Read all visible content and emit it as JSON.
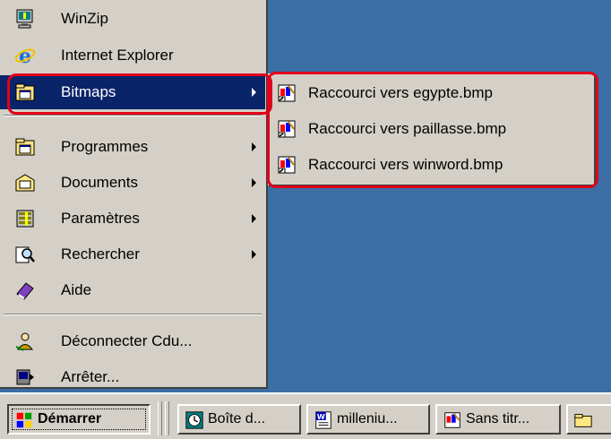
{
  "start_menu": {
    "top_items": [
      {
        "label": "WinZip",
        "icon": "winzip-icon"
      },
      {
        "label": "Internet Explorer",
        "icon": "internet-explorer-icon"
      },
      {
        "label": "Bitmaps",
        "icon": "folder-program-icon",
        "selected": true,
        "has_submenu": true
      }
    ],
    "main_items": [
      {
        "label": "Programmes",
        "icon": "programs-folder-icon",
        "has_submenu": true
      },
      {
        "label": "Documents",
        "icon": "documents-folder-icon",
        "has_submenu": true
      },
      {
        "label": "Paramètres",
        "icon": "settings-icon",
        "has_submenu": true
      },
      {
        "label": "Rechercher",
        "icon": "search-icon",
        "has_submenu": true
      },
      {
        "label": "Aide",
        "icon": "help-book-icon",
        "has_submenu": false
      }
    ],
    "bottom_items": [
      {
        "label": "Déconnecter Cdu...",
        "icon": "logoff-icon"
      },
      {
        "label": "Arrêter...",
        "icon": "shutdown-icon"
      }
    ]
  },
  "submenu": {
    "items": [
      {
        "label": "Raccourci vers egypte.bmp",
        "icon": "paint-shortcut-icon"
      },
      {
        "label": "Raccourci vers paillasse.bmp",
        "icon": "paint-shortcut-icon"
      },
      {
        "label": "Raccourci vers winword.bmp",
        "icon": "paint-shortcut-icon"
      }
    ]
  },
  "taskbar": {
    "start_label": "Démarrer",
    "buttons": [
      {
        "label": "Boîte d...",
        "icon": "outlook-icon"
      },
      {
        "label": "milleniu...",
        "icon": "word-doc-icon"
      },
      {
        "label": "Sans titr...",
        "icon": "paint-icon"
      }
    ]
  },
  "colors": {
    "desktop": "#3a6ea5",
    "menu_face": "#d4d0c8",
    "selection": "#0a246a",
    "highlight_ring": "#e2001a"
  }
}
